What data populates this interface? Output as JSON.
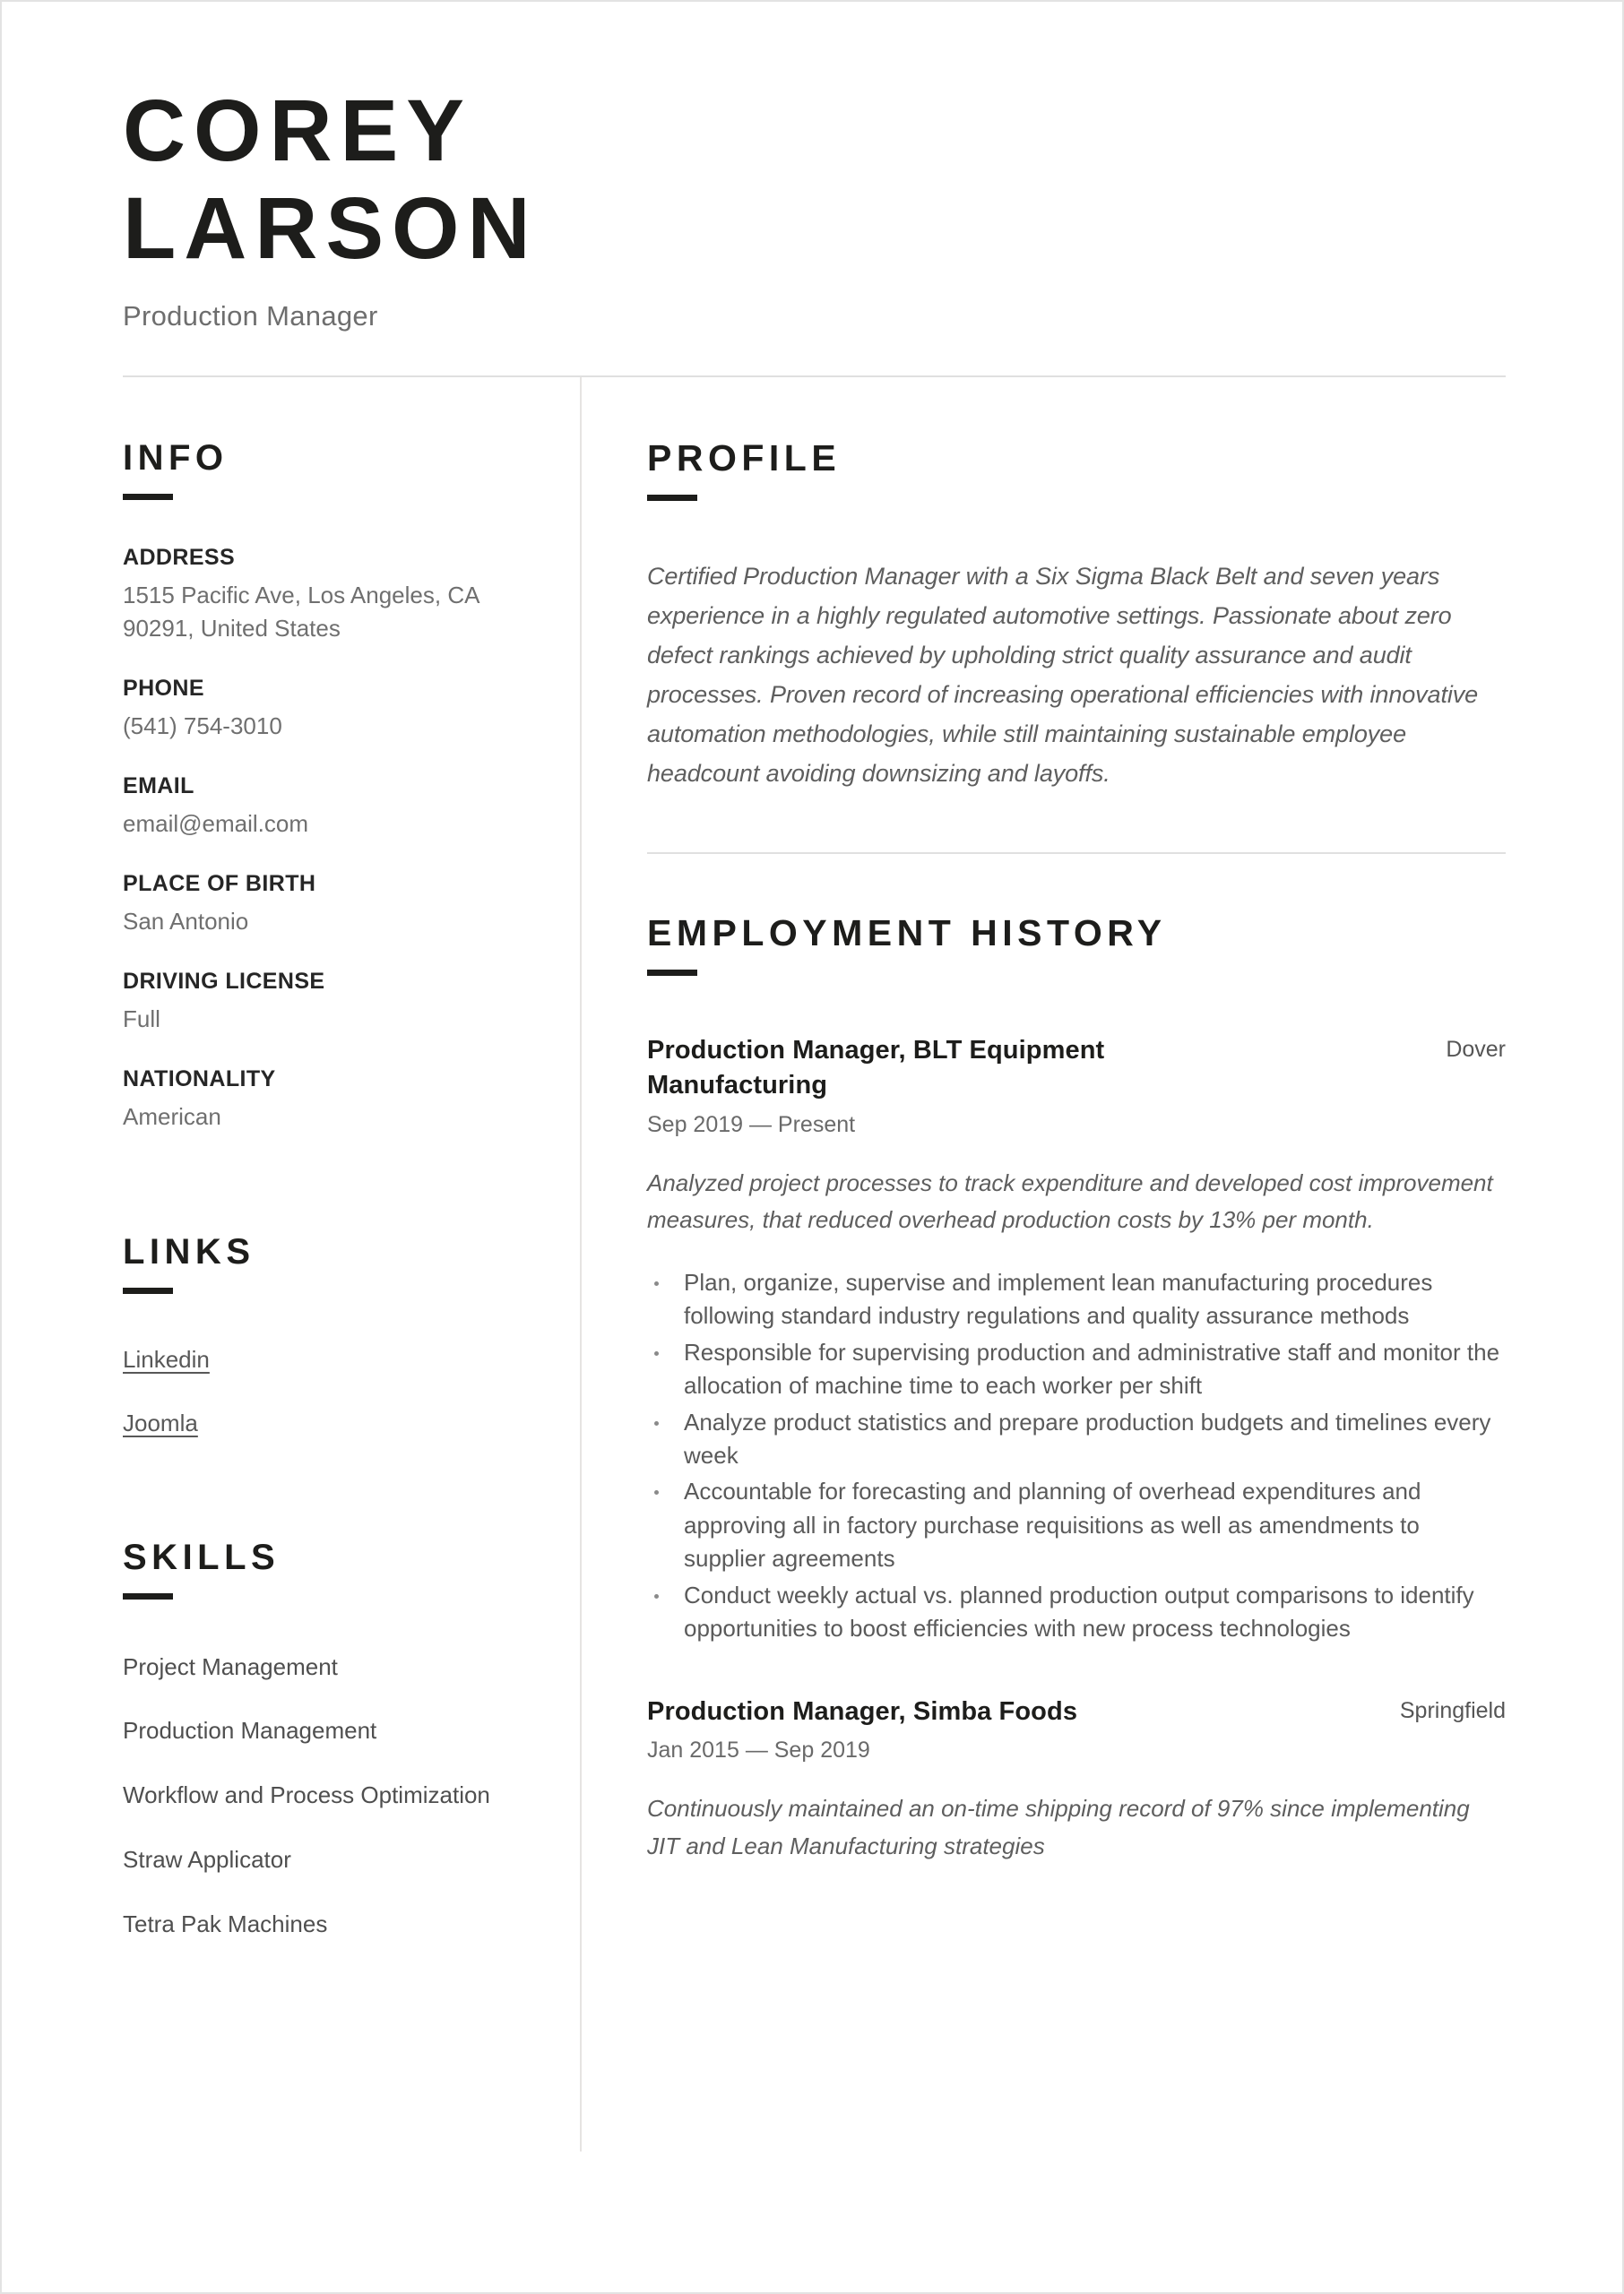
{
  "header": {
    "name": "COREY LARSON",
    "job_title": "Production Manager"
  },
  "sidebar": {
    "info": {
      "heading": "INFO",
      "fields": [
        {
          "label": "ADDRESS",
          "value": "1515 Pacific Ave, Los Angeles, CA 90291, United States"
        },
        {
          "label": "PHONE",
          "value": "(541) 754-3010"
        },
        {
          "label": "EMAIL",
          "value": "email@email.com"
        },
        {
          "label": "PLACE OF BIRTH",
          "value": "San Antonio"
        },
        {
          "label": "DRIVING LICENSE",
          "value": "Full"
        },
        {
          "label": "NATIONALITY",
          "value": "American"
        }
      ]
    },
    "links": {
      "heading": "LINKS",
      "items": [
        {
          "label": "Linkedin"
        },
        {
          "label": "Joomla"
        }
      ]
    },
    "skills": {
      "heading": "SKILLS",
      "items": [
        {
          "label": "Project Management"
        },
        {
          "label": "Production Management"
        },
        {
          "label": "Workflow and Process Optimization"
        },
        {
          "label": "Straw Applicator"
        },
        {
          "label": "Tetra Pak Machines"
        }
      ]
    }
  },
  "main": {
    "profile": {
      "heading": "PROFILE",
      "text": "Certified Production Manager with a Six Sigma Black Belt and seven years experience in a highly regulated automotive settings. Passionate about zero defect rankings achieved by upholding strict quality assurance and audit processes. Proven record of increasing operational efficiencies with innovative automation methodologies, while still maintaining sustainable employee headcount avoiding downsizing and layoffs."
    },
    "employment": {
      "heading": "EMPLOYMENT HISTORY",
      "jobs": [
        {
          "role": "Production Manager, BLT Equipment Manufacturing",
          "location": "Dover",
          "dates": "Sep 2019 — Present",
          "summary": "Analyzed project processes to track expenditure and developed cost improvement measures, that reduced overhead production costs by 13% per month.",
          "bullets": [
            "Plan, organize, supervise and implement lean manufacturing procedures following standard industry regulations and quality assurance methods",
            "Responsible for supervising production and administrative staff and monitor the allocation of machine time to each worker per shift",
            "Analyze product statistics and prepare production budgets and timelines every week",
            "Accountable for forecasting and planning of overhead expenditures and approving all in factory purchase requisitions as well as amendments to supplier agreements",
            "Conduct weekly actual vs. planned production output comparisons to identify opportunities to boost efficiencies with new process technologies"
          ]
        },
        {
          "role": "Production Manager, Simba Foods",
          "location": "Springfield",
          "dates": "Jan 2015 — Sep 2019",
          "summary": "Continuously maintained an on-time shipping record of 97% since implementing JIT and Lean Manufacturing strategies",
          "bullets": []
        }
      ]
    }
  },
  "colors": {
    "text_dark": "#1d1d1b",
    "text_gray": "#5e5e5e",
    "rule": "#e0e0e0"
  }
}
